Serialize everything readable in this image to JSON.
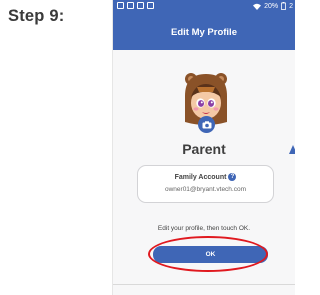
{
  "step": {
    "label": "Step 9:"
  },
  "status_bar": {
    "battery_text": "20%",
    "time_text": "2"
  },
  "header": {
    "title": "Edit My Profile"
  },
  "profile": {
    "name": "Parent",
    "avatar_icon": "bear-girl-avatar-icon",
    "camera_icon": "camera-icon"
  },
  "family_account": {
    "title": "Family Account",
    "email": "owner01@bryant.vtech.com"
  },
  "instruction": "Edit your profile, then touch OK.",
  "ok_button": {
    "label": "OK"
  },
  "colors": {
    "accent": "#3f66b6",
    "highlight": "#e0191f",
    "background": "#f7f7f8"
  }
}
